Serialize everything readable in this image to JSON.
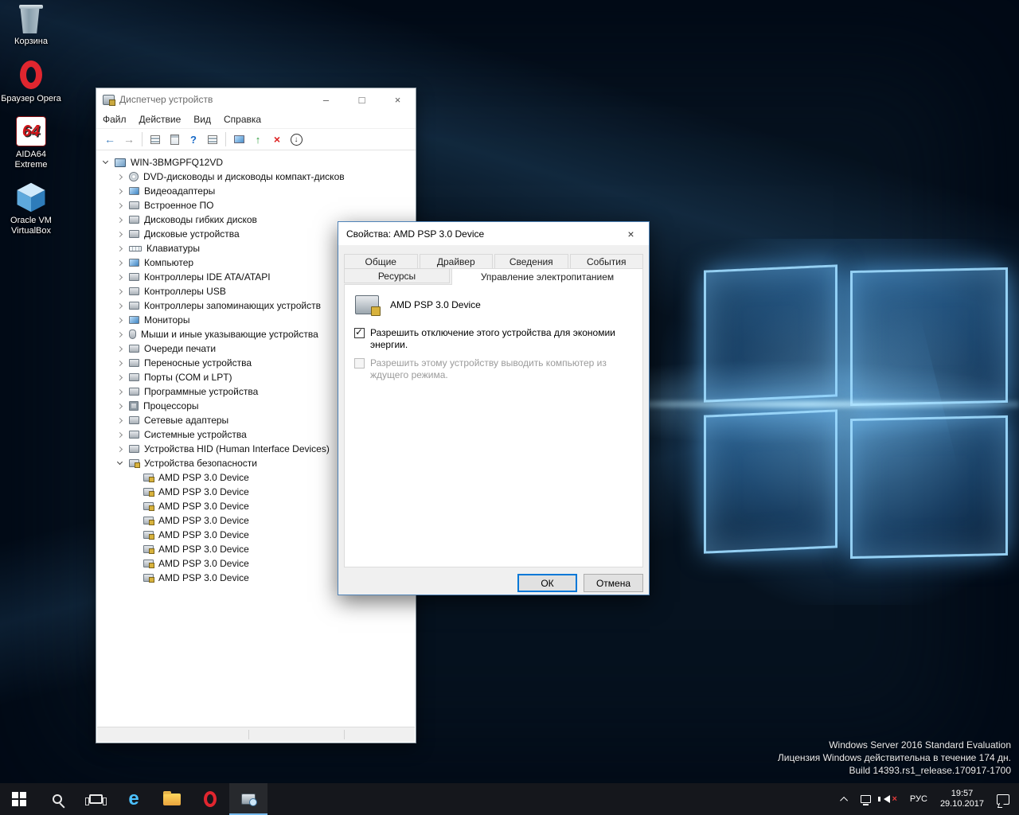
{
  "desktop": {
    "icons": [
      {
        "label": "Корзина",
        "name": "recycle-bin-icon"
      },
      {
        "label": "Браузер Opera",
        "name": "opera-icon"
      },
      {
        "label": "AIDA64 Extreme",
        "name": "aida64-icon",
        "badge": "64"
      },
      {
        "label": "Oracle VM VirtualBox",
        "name": "virtualbox-icon"
      }
    ],
    "watermark": [
      "Windows Server 2016 Standard Evaluation",
      "Лицензия Windows действительна в течение 174 дн.",
      "Build 14393.rs1_release.170917-1700"
    ]
  },
  "device_manager": {
    "title": "Диспетчер устройств",
    "menu": [
      "Файл",
      "Действие",
      "Вид",
      "Справка"
    ],
    "root": "WIN-3BMGPFQ12VD",
    "categories": [
      {
        "label": "DVD-дисководы и дисководы компакт-дисков",
        "icon": "dvd-drive-icon",
        "chev": "col"
      },
      {
        "label": "Видеоадаптеры",
        "icon": "video-adapter-icon",
        "chev": "col"
      },
      {
        "label": "Встроенное ПО",
        "icon": "firmware-icon",
        "chev": "col"
      },
      {
        "label": "Дисководы гибких дисков",
        "icon": "floppy-drive-icon",
        "chev": "col"
      },
      {
        "label": "Дисковые устройства",
        "icon": "disk-drive-icon",
        "chev": "col"
      },
      {
        "label": "Клавиатуры",
        "icon": "keyboard-icon",
        "chev": "col"
      },
      {
        "label": "Компьютер",
        "icon": "computer-icon",
        "chev": "col"
      },
      {
        "label": "Контроллеры IDE ATA/ATAPI",
        "icon": "ide-controller-icon",
        "chev": "col"
      },
      {
        "label": "Контроллеры USB",
        "icon": "usb-controller-icon",
        "chev": "col"
      },
      {
        "label": "Контроллеры запоминающих устройств",
        "icon": "storage-controller-icon",
        "chev": "col"
      },
      {
        "label": "Мониторы",
        "icon": "monitor-icon",
        "chev": "col"
      },
      {
        "label": "Мыши и иные указывающие устройства",
        "icon": "mouse-icon",
        "chev": "col"
      },
      {
        "label": "Очереди печати",
        "icon": "print-queue-icon",
        "chev": "col"
      },
      {
        "label": "Переносные устройства",
        "icon": "portable-device-icon",
        "chev": "col"
      },
      {
        "label": "Порты (COM и LPT)",
        "icon": "ports-icon",
        "chev": "col"
      },
      {
        "label": "Программные устройства",
        "icon": "software-device-icon",
        "chev": "col"
      },
      {
        "label": "Процессоры",
        "icon": "processor-icon",
        "chev": "col"
      },
      {
        "label": "Сетевые адаптеры",
        "icon": "network-adapter-icon",
        "chev": "col"
      },
      {
        "label": "Системные устройства",
        "icon": "system-device-icon",
        "chev": "col"
      },
      {
        "label": "Устройства HID (Human Interface Devices)",
        "icon": "hid-device-icon",
        "chev": "col"
      },
      {
        "label": "Устройства безопасности",
        "icon": "security-category-icon",
        "chev": "exp"
      }
    ],
    "security_children": [
      "AMD PSP 3.0 Device",
      "AMD PSP 3.0 Device",
      "AMD PSP 3.0 Device",
      "AMD PSP 3.0 Device",
      "AMD PSP 3.0 Device",
      "AMD PSP 3.0 Device",
      "AMD PSP 3.0 Device",
      "AMD PSP 3.0 Device"
    ]
  },
  "dialog": {
    "title": "Свойства: AMD PSP 3.0 Device",
    "tabs_row1": [
      "Общие",
      "Драйвер",
      "Сведения",
      "События"
    ],
    "tabs_row2": [
      {
        "label": "Ресурсы",
        "cls": "rsrc"
      },
      {
        "label": "Управление электропитанием",
        "cls": "active"
      }
    ],
    "device_name": "AMD PSP 3.0 Device",
    "checkbox_allow_off": "Разрешить отключение этого устройства для экономии энергии.",
    "checkbox_allow_wake": "Разрешить этому устройству выводить компьютер из ждущего режима.",
    "ok_label": "ОК",
    "cancel_label": "Отмена"
  },
  "taskbar": {
    "edge_glyph": "e",
    "tray": {
      "lang": "РУС",
      "time": "19:57",
      "date": "29.10.2017"
    }
  }
}
